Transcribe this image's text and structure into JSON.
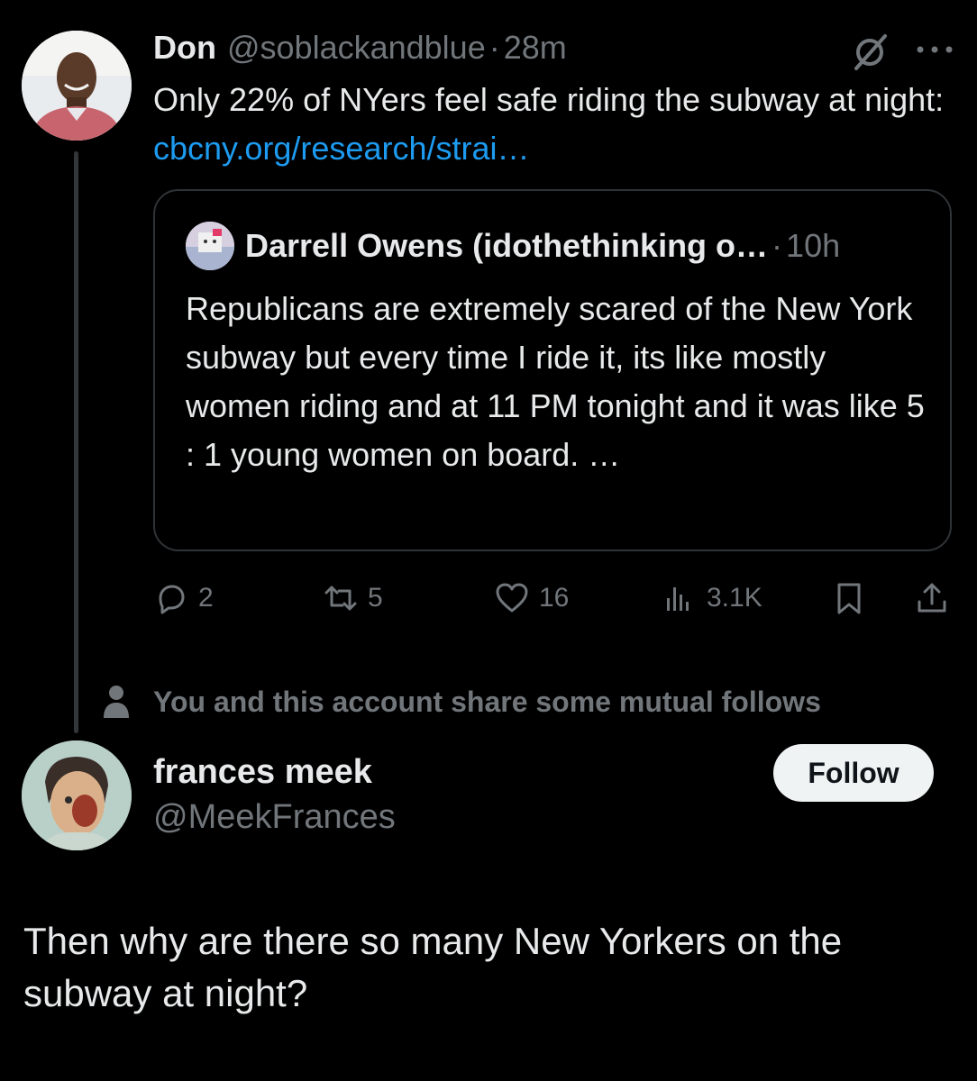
{
  "tweet": {
    "author_name": "Don",
    "author_handle": "@soblackandblue",
    "separator": "·",
    "time": "28m",
    "text_before_link": "Only 22% of NYers feel safe riding the subway at night: ",
    "link_text": "cbcny.org/research/strai…",
    "quote": {
      "author_name": "Darrell Owens (idothethinking o…",
      "separator": "·",
      "time": "10h",
      "text": "Republicans are extremely scared of the New York subway but every time I ride it, its like mostly women riding and at 11 PM tonight and it was like 5 : 1 young women on board. …"
    },
    "actions": {
      "replies": "2",
      "reposts": "5",
      "likes": "16",
      "views": "3.1K"
    }
  },
  "mutual_follows_text": "You and this account share some mutual follows",
  "reply": {
    "author_name": "frances meek",
    "author_handle": "@MeekFrances",
    "follow_label": "Follow",
    "text": "Then why are there so many New Yorkers on the subway at night?"
  },
  "colors": {
    "background": "#000000",
    "text": "#e7e9ea",
    "secondary": "#71767b",
    "link": "#1d9bf0",
    "border": "#2f3336"
  }
}
